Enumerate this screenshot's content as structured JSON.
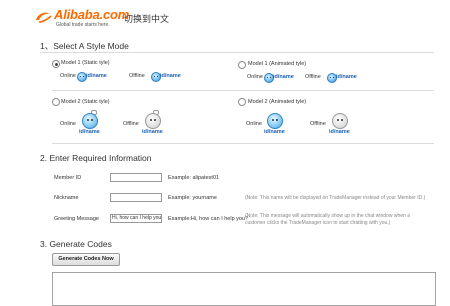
{
  "header": {
    "logo_text": "Alibaba.com",
    "logo_tagline": "Global trade starts here.",
    "switch_language": "切换到中文"
  },
  "section1": {
    "title": "1、Select A Style Mode",
    "models": [
      {
        "label": "Model 1 (Static tyle)",
        "selected": true,
        "online": "Online",
        "offline": "Offline",
        "online_id": "id/name",
        "offline_id": "id/name"
      },
      {
        "label": "Model 1 (Animated tyle)",
        "selected": false,
        "online": "Online",
        "offline": "Offline",
        "online_id": "id/name",
        "offline_id": "id/name"
      },
      {
        "label": "Model 2 (Static tyle)",
        "selected": false,
        "online": "Online",
        "offline": "Offline",
        "online_id": "id/name",
        "offline_id": "id/name"
      },
      {
        "label": "Model 2 (Animated tyle)",
        "selected": false,
        "online": "Online",
        "offline": "Offline",
        "online_id": "id/name",
        "offline_id": "id/name"
      }
    ]
  },
  "section2": {
    "title": "2. Enter Required Information",
    "fields": [
      {
        "label": "Member ID",
        "value": "",
        "example": "Example: alipatest01",
        "note": ""
      },
      {
        "label": "Nickname",
        "value": "",
        "example": "Example: yourname",
        "note": "(Note: This name will be displayed on TradeManager instead of your Member ID.)"
      },
      {
        "label": "Greeting Message",
        "value": "Hi, how can I help you?",
        "example": "Example:Hi, how can I help you?",
        "note": "(Note: This message will automatically show up in the chat window when a customer clicks the TradeManager icon to start chatting with you.)"
      }
    ]
  },
  "section3": {
    "title": "3. Generate Codes",
    "button_label": "Generate Codes Now",
    "output_value": ""
  },
  "colors": {
    "brand": "#ff6a00",
    "link": "#1a5fb4"
  }
}
